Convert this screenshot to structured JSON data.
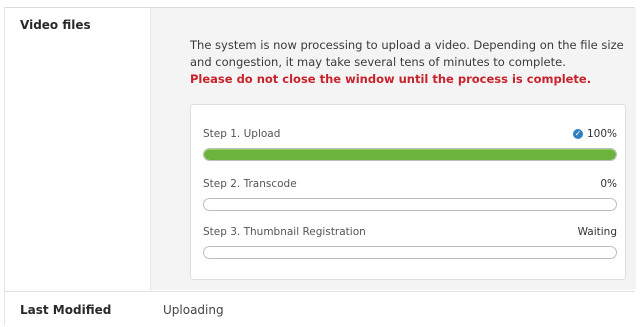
{
  "video_files": {
    "label": "Video files",
    "message": "The system is now processing to upload a video. Depending on the file size and congestion, it may take several tens of minutes to complete.",
    "warning": "Please do not close the window until the process is complete.",
    "steps": [
      {
        "label": "Step 1. Upload",
        "status": "100%",
        "progress": 1.0,
        "icon": "check-circle-icon"
      },
      {
        "label": "Step 2. Transcode",
        "status": "0%",
        "progress": 0.0
      },
      {
        "label": "Step 3. Thumbnail Registration",
        "status": "Waiting",
        "progress": 0.0
      }
    ]
  },
  "last_modified": {
    "label": "Last Modified",
    "value": "Uploading"
  },
  "colors": {
    "warning": "#c8232c",
    "progress_fill": "#6cb33e",
    "check_icon": "#2f7fc1"
  }
}
